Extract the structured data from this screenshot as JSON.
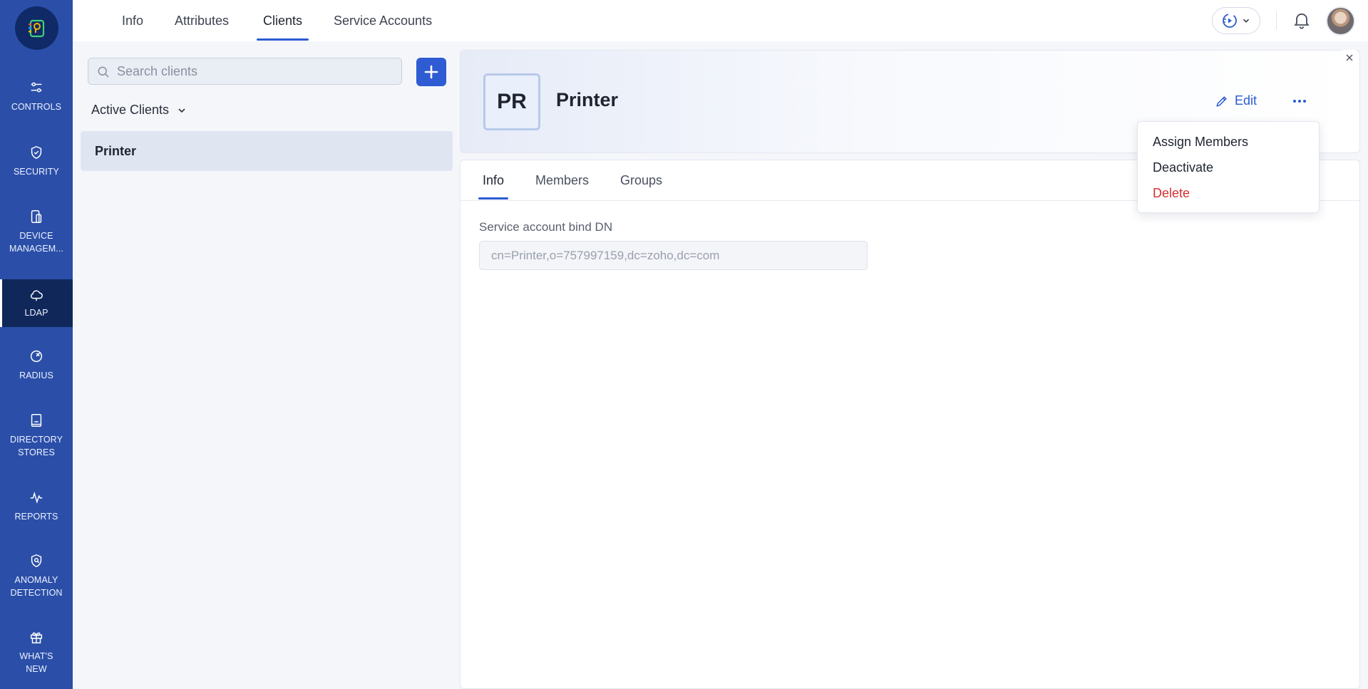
{
  "sidebar": {
    "logo": "zoho-directory-logo",
    "items": [
      {
        "label": "CONTROLS",
        "icon": "sliders-icon"
      },
      {
        "label": "SECURITY",
        "icon": "shield-icon"
      },
      {
        "label": "DEVICE MANAGEM...",
        "icon": "device-icon"
      },
      {
        "label": "LDAP",
        "icon": "cloud-icon",
        "active": true
      },
      {
        "label": "RADIUS",
        "icon": "radar-icon"
      },
      {
        "label": "DIRECTORY STORES",
        "icon": "book-icon"
      },
      {
        "label": "REPORTS",
        "icon": "activity-icon"
      },
      {
        "label": "ANOMALY DETECTION",
        "icon": "shield-search-icon"
      },
      {
        "label": "WHAT'S NEW",
        "icon": "gift-icon"
      }
    ]
  },
  "topbar": {
    "tabs": [
      "Info",
      "Attributes",
      "Clients",
      "Service Accounts"
    ],
    "active_tab": "Clients"
  },
  "list": {
    "search_placeholder": "Search clients",
    "filter_label": "Active Clients",
    "items": [
      "Printer"
    ]
  },
  "detail": {
    "initials": "PR",
    "name": "Printer",
    "edit_label": "Edit",
    "tabs": [
      "Info",
      "Members",
      "Groups"
    ],
    "active_tab": "Info",
    "field_label": "Service account bind DN",
    "field_value": "cn=Printer,o=757997159,dc=zoho,dc=com"
  },
  "menu": {
    "items": [
      "Assign Members",
      "Deactivate",
      "Delete"
    ]
  },
  "colors": {
    "sidebar": "#2b4fa8",
    "sidebar_active": "#0f2759",
    "accent": "#2b5bd0",
    "danger": "#d32f2f"
  }
}
